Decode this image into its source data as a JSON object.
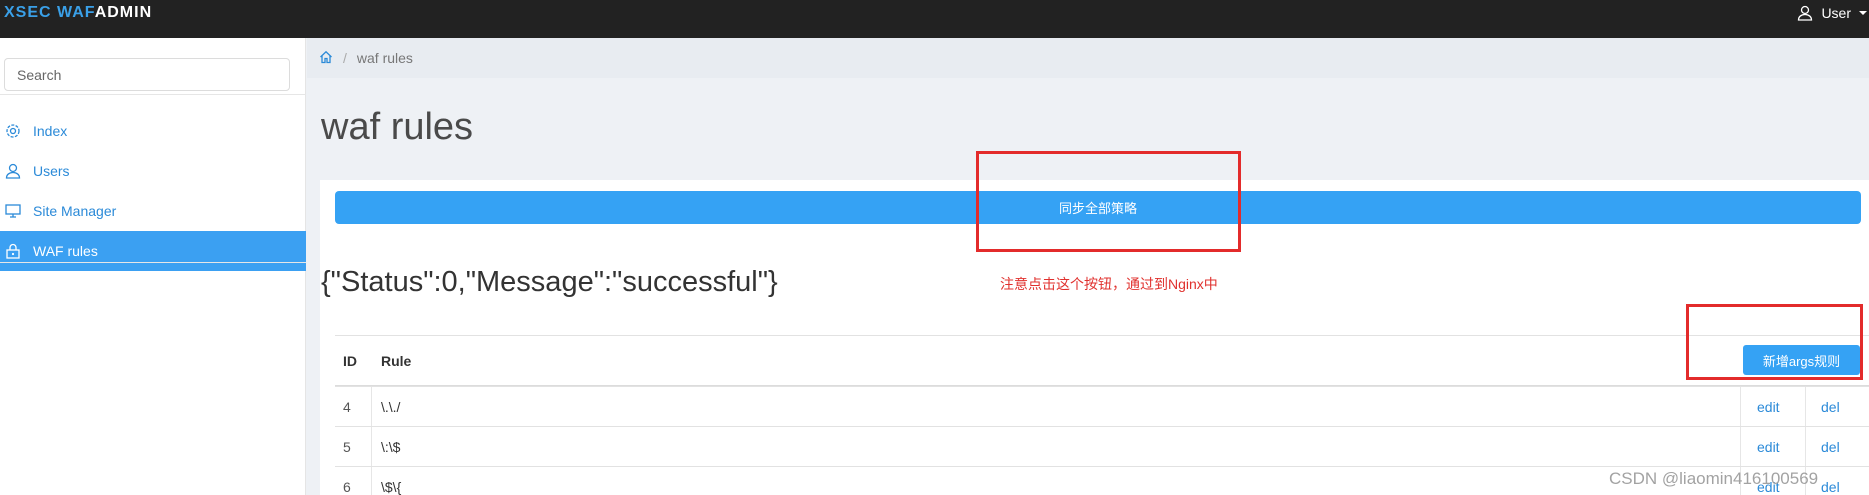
{
  "header": {
    "brand_part1": "XSEC WAF",
    "brand_part2": "ADMIN",
    "user_label": "User"
  },
  "sidebar": {
    "search_placeholder": "Search",
    "items": [
      {
        "label": "Index",
        "icon": "gear-icon"
      },
      {
        "label": "Users",
        "icon": "user-icon"
      },
      {
        "label": "Site Manager",
        "icon": "monitor-icon"
      },
      {
        "label": "WAF rules",
        "icon": "lock-icon",
        "active": true
      }
    ]
  },
  "breadcrumb": {
    "home_icon": "home-icon",
    "current": "waf rules"
  },
  "main": {
    "title": "waf rules",
    "sync_button": "同步全部策略",
    "status_text": "{\"Status\":0,\"Message\":\"successful\"}",
    "note": "注意点击这个按钮，通过到Nginx中",
    "add_button": "新增args规则",
    "table": {
      "columns": [
        "ID",
        "Rule"
      ],
      "rows": [
        {
          "id": "4",
          "rule": "\\.\\./",
          "edit": "edit",
          "del": "del"
        },
        {
          "id": "5",
          "rule": "\\:\\$",
          "edit": "edit",
          "del": "del"
        },
        {
          "id": "6",
          "rule": "\\$\\{",
          "edit": "edit",
          "del": "del"
        }
      ]
    }
  },
  "watermark": "CSDN @liaomin416100569",
  "colors": {
    "topbar": "#222222",
    "accent": "#35a2f4",
    "annotation": "#e32b2b"
  }
}
